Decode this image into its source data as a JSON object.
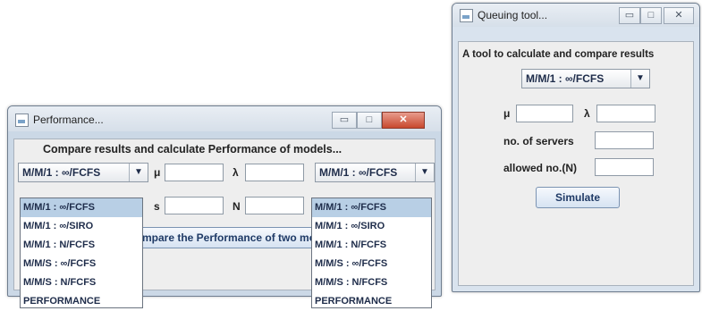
{
  "queuing": {
    "title": "Queuing tool...",
    "controls": {
      "minimize": "▭",
      "maximize": "□",
      "close": "✕"
    },
    "description": "A tool to calculate and compare results",
    "model_selected": "M/M/1 : ∞/FCFS",
    "mu_label": "μ",
    "lambda_label": "λ",
    "servers_label": "no. of servers",
    "allowed_label": "allowed no.(N)",
    "simulate_label": "Simulate"
  },
  "performance": {
    "title": "Performance...",
    "controls": {
      "minimize": "▭",
      "maximize": "□",
      "close": "✕"
    },
    "description": "Compare results and calculate Performance of models...",
    "left_selected": "M/M/1 : ∞/FCFS",
    "right_selected": "M/M/1 : ∞/FCFS",
    "mu_label": "μ",
    "lambda_label": "λ",
    "s_label": "s",
    "n_label": "N",
    "compare_button": "Compare the Performance of two models",
    "options": [
      "M/M/1 : ∞/FCFS",
      "M/M/1 : ∞/SIRO",
      "M/M/1 : N/FCFS",
      "M/M/S : ∞/FCFS",
      "M/M/S : N/FCFS",
      "PERFORMANCE"
    ]
  }
}
